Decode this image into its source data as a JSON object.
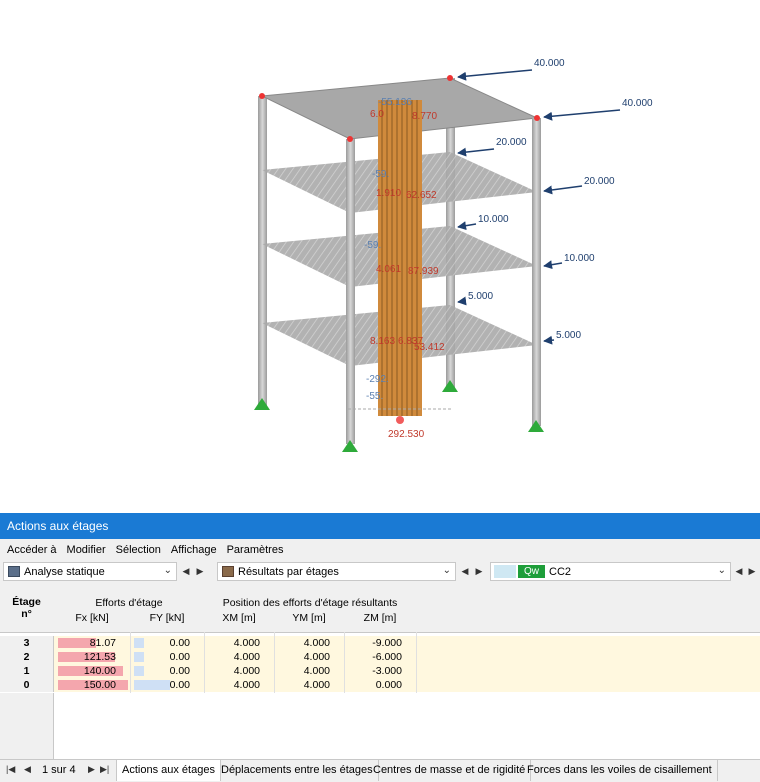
{
  "viewport": {
    "loads": [
      "40.000",
      "40.000",
      "20.000",
      "20.000",
      "10.000",
      "10.000",
      "5.000",
      "5.000"
    ],
    "result_labels_red": [
      "6.0",
      "8.770",
      "1.910",
      "62.652",
      "4.061",
      "87.939",
      "8.163",
      "6.837",
      "53.412",
      "292.530"
    ],
    "result_labels_blue": [
      "-55.136",
      "-59.",
      "-59.",
      "-292.",
      "-55."
    ]
  },
  "panel": {
    "title": "Actions aux étages",
    "menu": [
      "Accéder à",
      "Modifier",
      "Sélection",
      "Affichage",
      "Paramètres"
    ],
    "toolbar": {
      "analysis": "Analyse statique",
      "results": "Résultats par étages",
      "load_badge": "Qw",
      "load_case": "CC2"
    },
    "table": {
      "col_storey": [
        "Étage",
        "n°"
      ],
      "group_forces": "Efforts d'étage",
      "group_position": "Position des efforts d'étage résultants",
      "headers": [
        "Fx [kN]",
        "FY [kN]",
        "XM [m]",
        "YM [m]",
        "ZM [m]"
      ],
      "rows": [
        {
          "storey": "3",
          "fx": "81.07",
          "fy": "0.00",
          "xm": "4.000",
          "ym": "4.000",
          "zm": "-9.000"
        },
        {
          "storey": "2",
          "fx": "121.53",
          "fy": "0.00",
          "xm": "4.000",
          "ym": "4.000",
          "zm": "-6.000"
        },
        {
          "storey": "1",
          "fx": "140.00",
          "fy": "0.00",
          "xm": "4.000",
          "ym": "4.000",
          "zm": "-3.000"
        },
        {
          "storey": "0",
          "fx": "150.00",
          "fy": "0.00",
          "xm": "4.000",
          "ym": "4.000",
          "zm": "0.000"
        }
      ],
      "fx_max": 150
    },
    "pager": "1 sur 4",
    "tabs": [
      "Actions aux étages",
      "Déplacements entre les étages",
      "Centres de masse et de rigidité",
      "Forces dans les voiles de cisaillement"
    ],
    "colors": {
      "accent": "#1a7ad4",
      "fx_bar": "#f4a6ad",
      "fy_bar": "#cfe0f5",
      "selected_row": "#fff8df"
    }
  }
}
